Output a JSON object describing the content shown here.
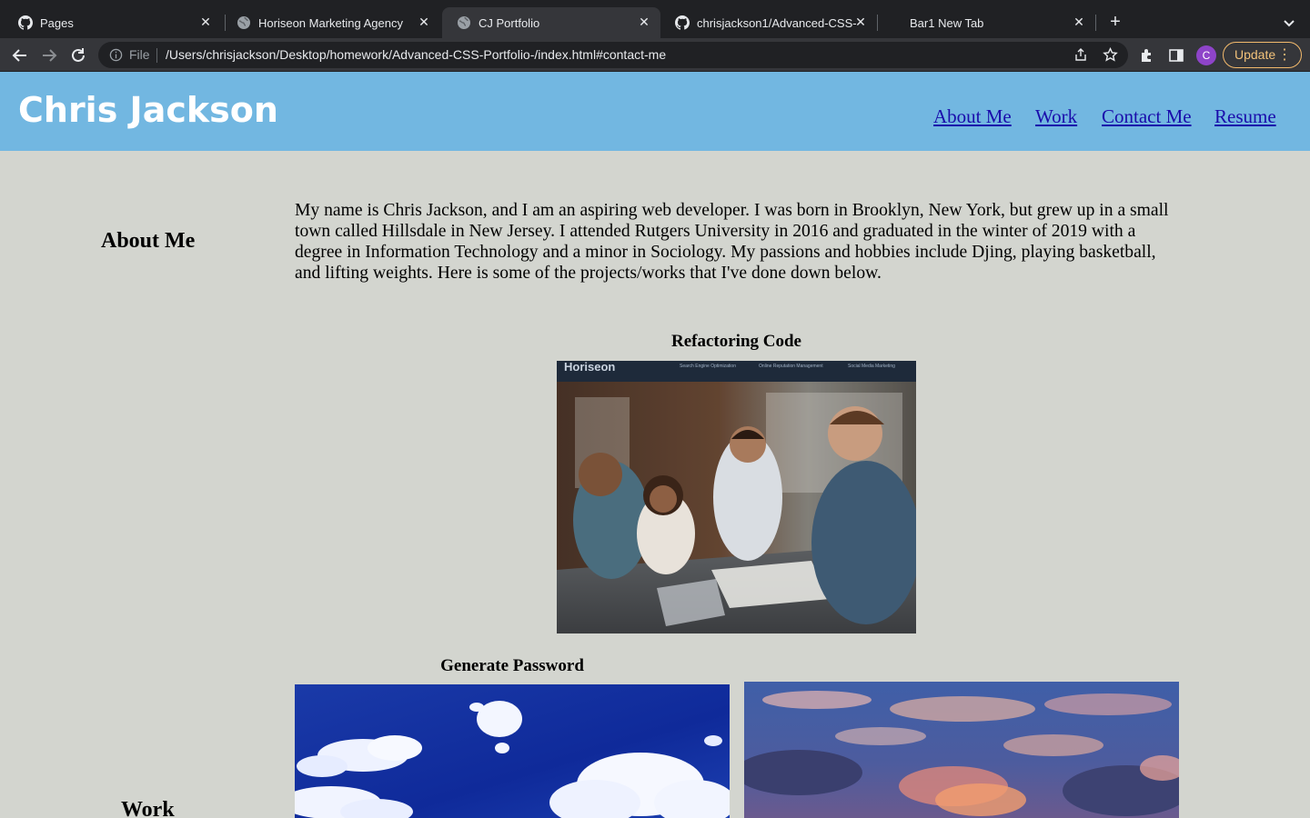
{
  "browser": {
    "tabs": [
      {
        "label": "Pages",
        "icon": "github-icon",
        "active": false
      },
      {
        "label": "Horiseon Marketing Agency",
        "icon": "globe-icon",
        "active": false
      },
      {
        "label": "CJ Portfolio",
        "icon": "globe-icon",
        "active": true
      },
      {
        "label": "chrisjackson1/Advanced-CSS-",
        "icon": "github-icon",
        "active": false
      },
      {
        "label": "Bar1 New Tab",
        "icon": "none",
        "active": false
      }
    ],
    "address": {
      "scheme_label": "File",
      "url": "/Users/chrisjackson/Desktop/homework/Advanced-CSS-Portfolio-/index.html#contact-me"
    },
    "profile_initial": "C",
    "update_label": "Update",
    "colors": {
      "chrome_dark": "#202124",
      "chrome_toolbar": "#35363a",
      "update_accent": "#f2b96c",
      "avatar": "#8e44c9"
    }
  },
  "site": {
    "name": "Chris Jackson",
    "nav": [
      "About Me",
      "Work",
      "Contact Me",
      "Resume"
    ],
    "colors": {
      "header_bg": "#72b7e1",
      "page_bg": "#d3d5cf",
      "link": "#1a0dab"
    }
  },
  "about": {
    "heading": "About Me",
    "text": "My name is Chris Jackson, and I am an aspiring web developer. I was born in Brooklyn, New York, but grew up in a small town called Hillsdale in New Jersey. I attended Rutgers University in 2016 and graduated in the winter of 2019 with a degree in Information Technology and a minor in Sociology. My passions and hobbies include Djing, playing basketball, and lifting weights. Here is some of the projects/works that I've done down below."
  },
  "work": {
    "heading": "Work",
    "projects": [
      {
        "title": "Refactoring Code",
        "screenshot_brand": "Horiseon",
        "screenshot_nav": [
          "Search Engine Optimization",
          "Online Reputation Management",
          "Social Media Marketing"
        ]
      },
      {
        "title": "Generate Password"
      }
    ]
  }
}
